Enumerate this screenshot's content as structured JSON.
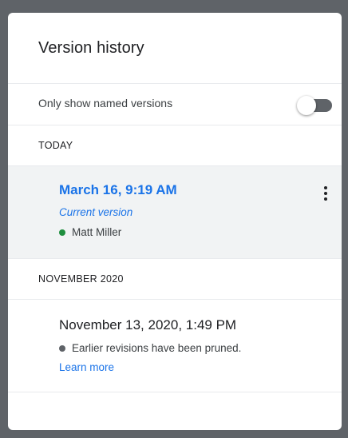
{
  "panel": {
    "title": "Version history"
  },
  "filter": {
    "label": "Only show named versions",
    "enabled": false
  },
  "sections": [
    {
      "header": "TODAY",
      "versions": [
        {
          "date": "March 16, 9:19 AM",
          "subtitle": "Current version",
          "author": "Matt Miller",
          "author_color": "#1e8e3e",
          "more_icon": "more-vert-icon"
        }
      ]
    },
    {
      "header": "NOVEMBER 2020",
      "versions": [
        {
          "date": "November 13, 2020, 1:49 PM",
          "note": "Earlier revisions have been pruned.",
          "note_dot_color": "#5f6368",
          "link": "Learn more"
        }
      ]
    }
  ],
  "colors": {
    "accent": "#1a73e8",
    "selected_bg": "#f1f3f4",
    "frame": "#5f6368"
  }
}
